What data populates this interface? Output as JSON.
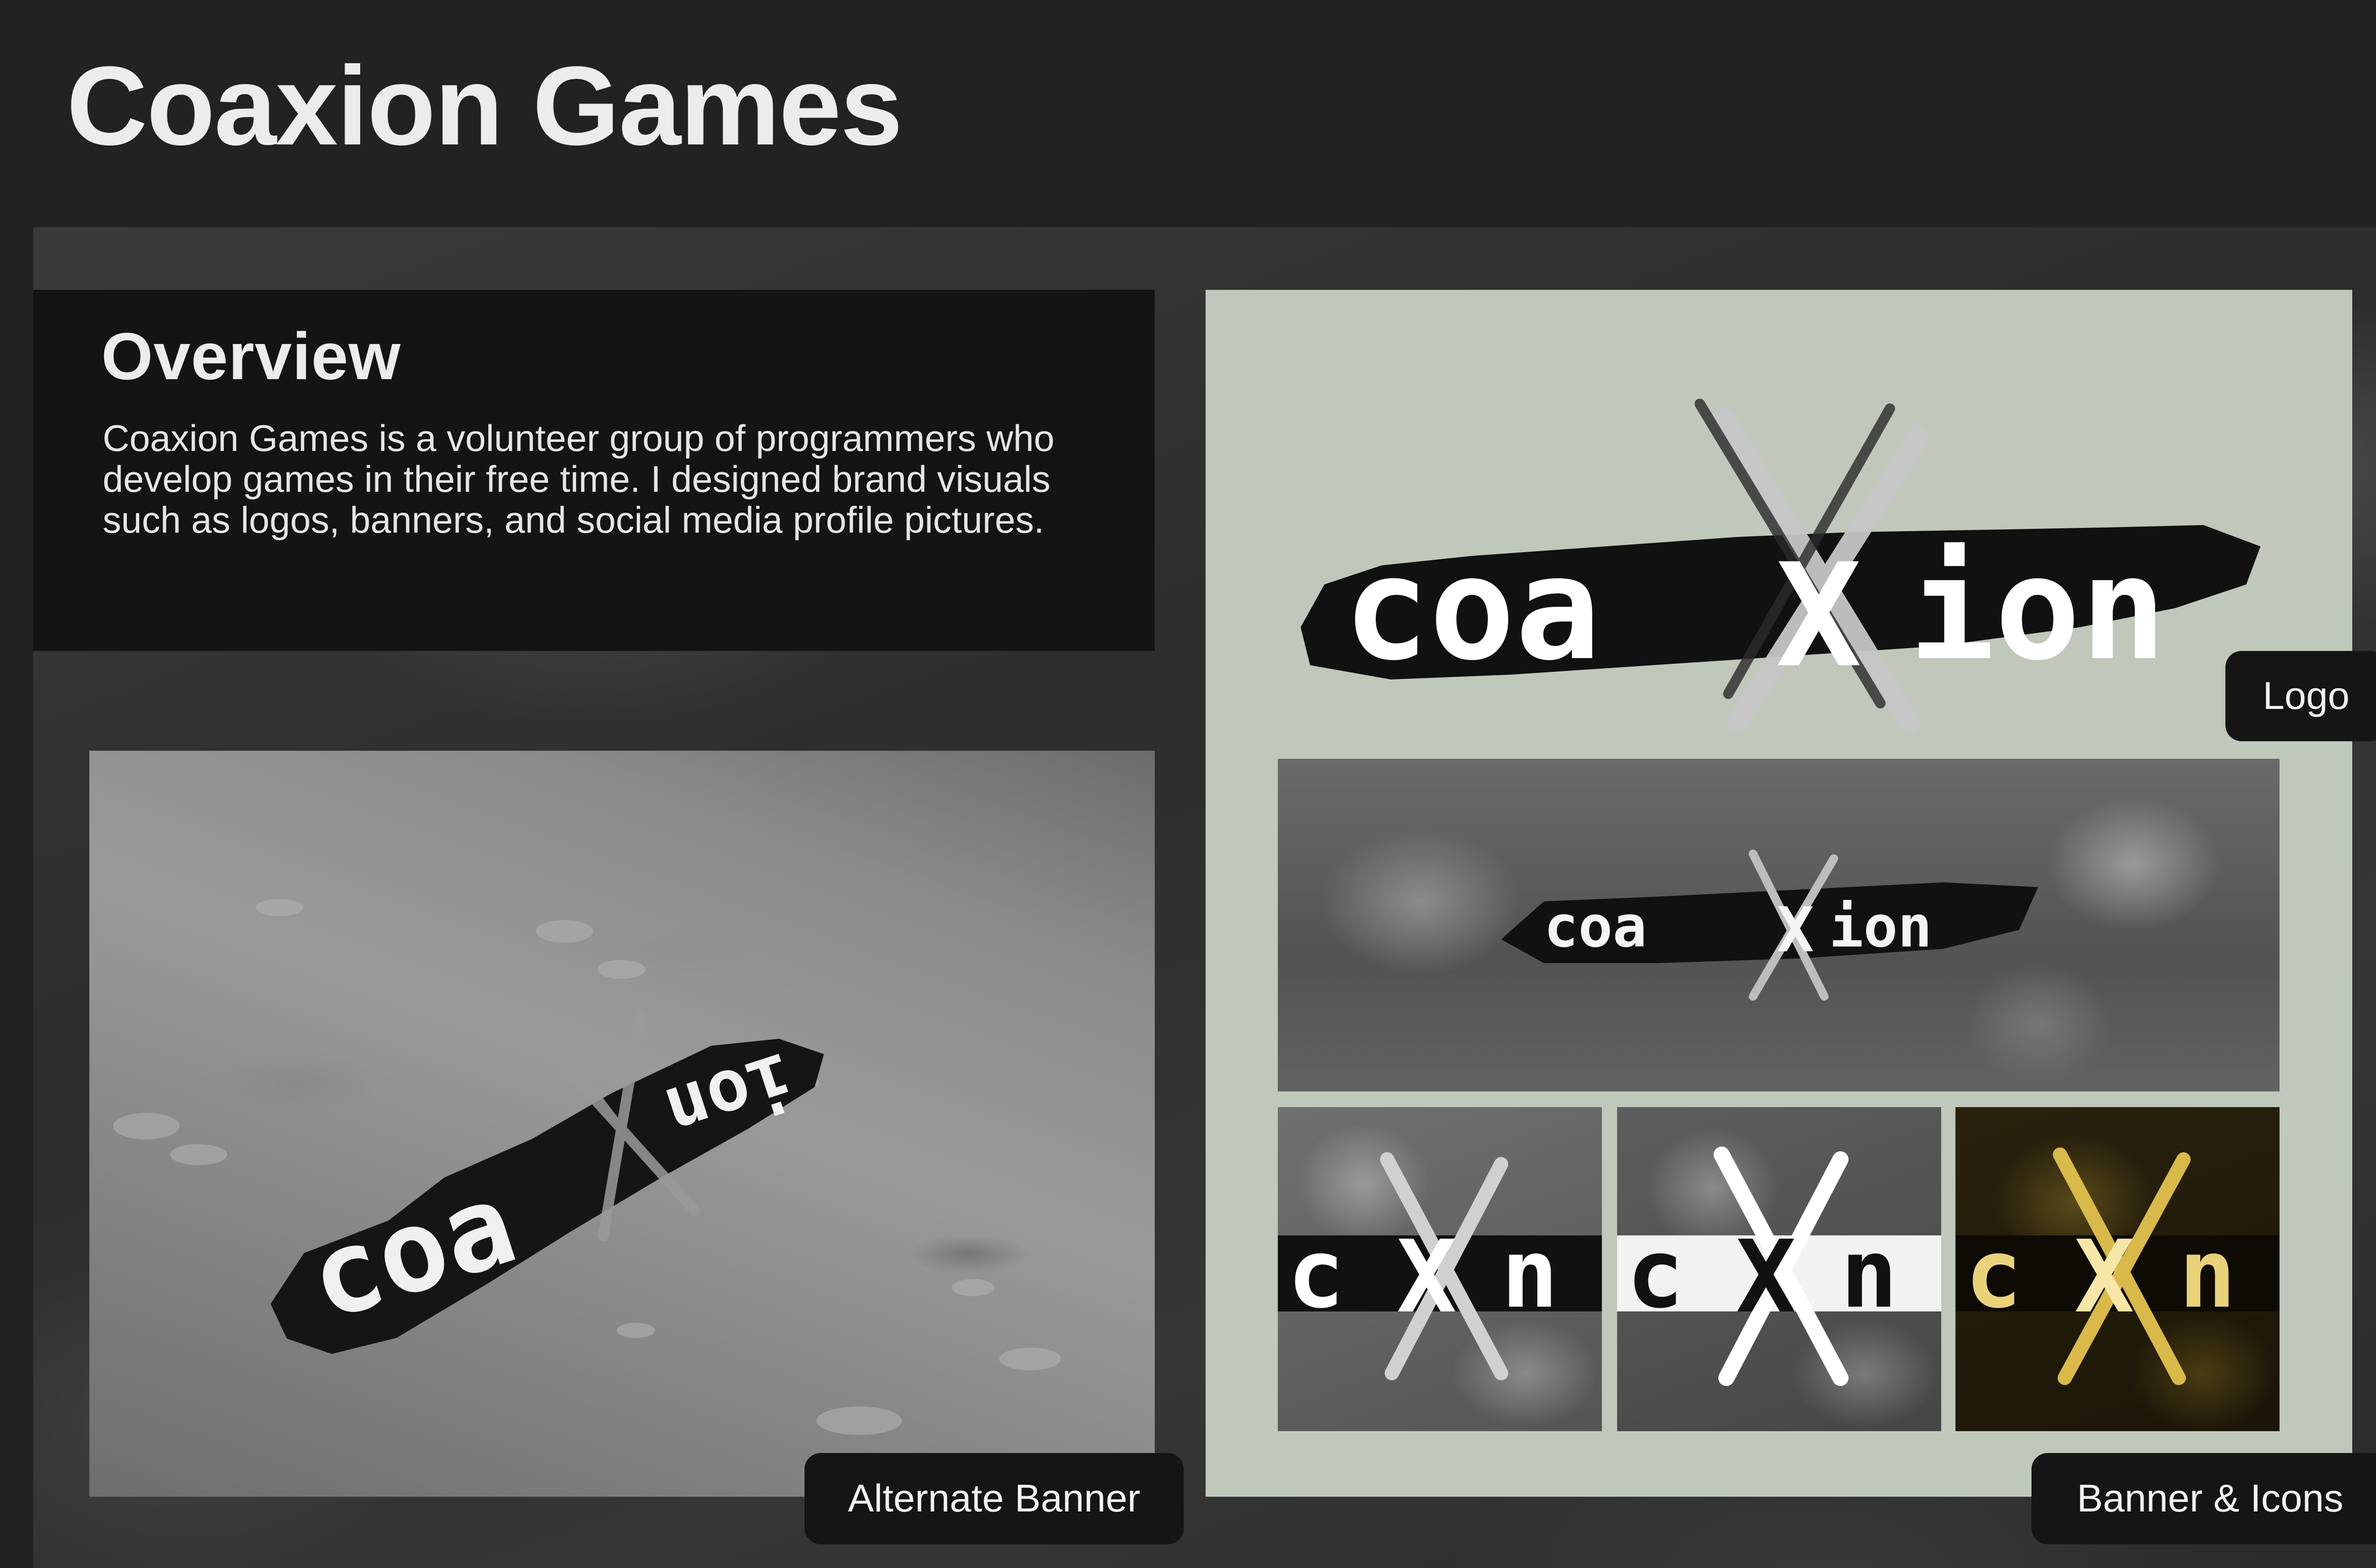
{
  "page": {
    "title": "Coaxion Games"
  },
  "overview": {
    "heading": "Overview",
    "body": "Coaxion Games is a volunteer group of programmers who develop games in their free time. I designed brand visuals such as logos, banners, and social media profile pictures."
  },
  "logo": {
    "left": "coa",
    "mark": "X",
    "right": "ion"
  },
  "icons": [
    {
      "left": "c",
      "mark": "X",
      "right": "n",
      "style": "dark"
    },
    {
      "left": "c",
      "mark": "X",
      "right": "n",
      "style": "white"
    },
    {
      "left": "c",
      "mark": "X",
      "right": "n",
      "style": "gold"
    }
  ],
  "labels": {
    "alternate_banner": "Alternate Banner",
    "logo": "Logo",
    "banner_icons": "Banner & Icons"
  },
  "colors": {
    "background": "#222222",
    "panel": "#bfc8bb",
    "card": "#141414",
    "gold": "#d8b94a"
  }
}
